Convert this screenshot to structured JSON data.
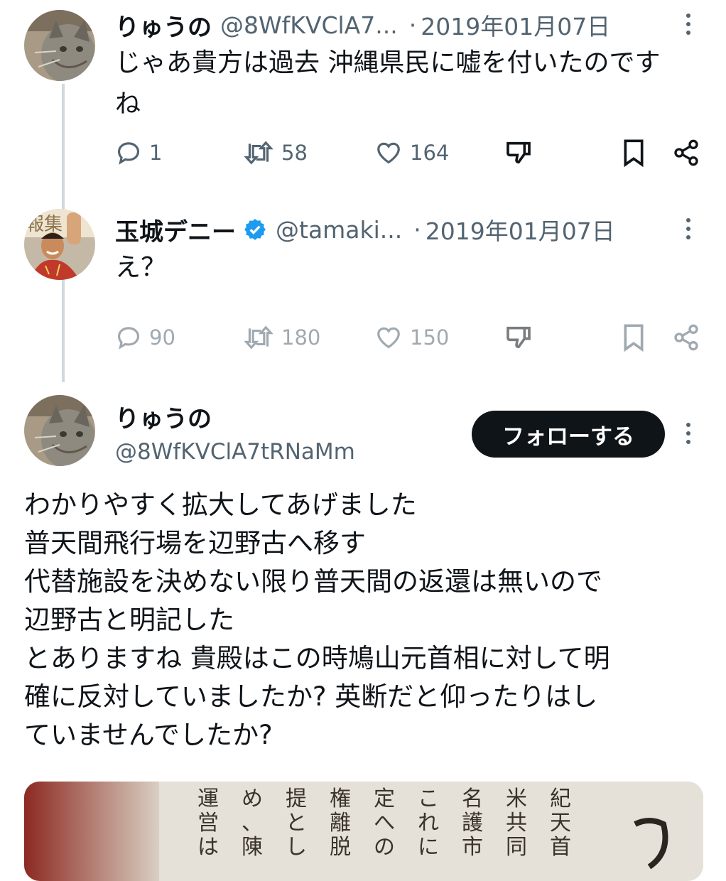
{
  "tweets": [
    {
      "name": "りゅうの",
      "handle": "@8WfKVClA7...",
      "date": "2019年01月07日",
      "text": [
        "じゃあ貴方は過去 沖縄県民に嘘を付いたのですね"
      ],
      "replies": "1",
      "retweets": "58",
      "likes": "164",
      "avatar": "cat-avatar"
    },
    {
      "name": "玉城デニー",
      "handle": "@tamaki...",
      "date": "2019年01月07日",
      "text": [
        "え？"
      ],
      "replies": "90",
      "retweets": "180",
      "likes": "150",
      "verified": true,
      "avatar": "man-avatar"
    }
  ],
  "main_tweet": {
    "name": "りゅうの",
    "handle": "@8WfKVClA7tRNaMm",
    "follow_label": "フォローする",
    "lines": [
      "わかりやすく拡大してあげました",
      "普天間飛行場を辺野古へ移す",
      "代替施設を決めない限り普天間の返還は無いので",
      "辺野古と明記した",
      "とありますね 貴殿はこの時鳩山元首相に対して明",
      "確に反対していましたか? 英断だと仰ったりはし",
      "ていませんでしたか?"
    ]
  },
  "newspaper_snippet": [
    "紀天首",
    "米共同",
    "名護市",
    "これに",
    "定への",
    "権離脱",
    "提とし",
    "め、陳",
    "運営は"
  ],
  "colors": {
    "text": "#0f1419",
    "secondary": "#536471",
    "line": "#cfd9de",
    "verified": "#1d9bf0"
  }
}
